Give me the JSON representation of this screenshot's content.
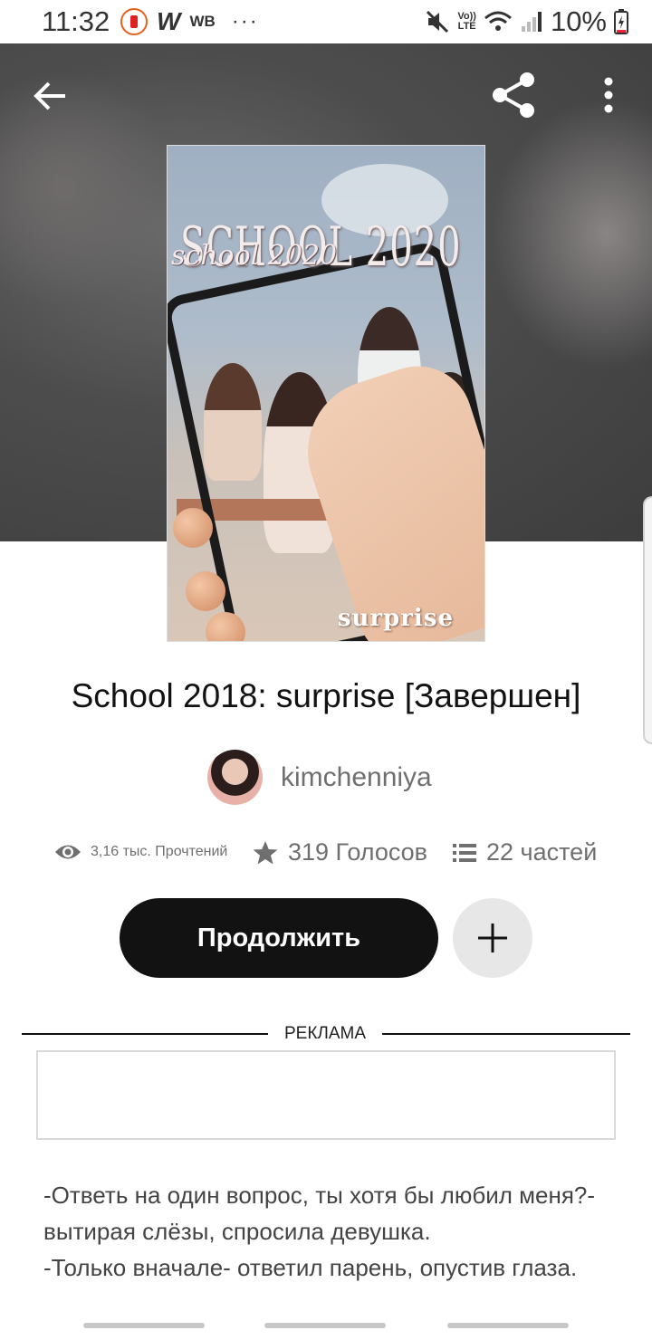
{
  "status_bar": {
    "time": "11:32",
    "app_w": "W",
    "app_wb": "WB",
    "more": "···",
    "lte_top": "Vo))",
    "lte_bottom": "LTE",
    "battery_percent": "10%",
    "icons": [
      "notification-app-icon",
      "wattpad-icon",
      "mute-icon",
      "volte-icon",
      "wifi-icon",
      "signal-icon",
      "battery-charging-icon"
    ]
  },
  "toolbar": {
    "back_icon": "arrow-left-icon",
    "share_icon": "share-icon",
    "more_icon": "more-vertical-icon"
  },
  "cover": {
    "title_print": "SCHOOL 2020",
    "title_script": "school 2020",
    "subtitle": "surprise"
  },
  "story": {
    "title": "School 2018: surprise [Завершен]",
    "author": "kimchenniya",
    "reads": "3,16 тыс. Прочтений",
    "votes": "319 Голосов",
    "parts": "22 частей"
  },
  "actions": {
    "continue_label": "Продолжить",
    "add_icon": "plus-icon"
  },
  "ad": {
    "label": "РЕКЛАМА"
  },
  "description": {
    "line1": "-Ответь на один вопрос, ты хотя бы любил меня?-вытирая слёзы, спросила девушка.",
    "line2": "-Только вначале- ответил парень, опустив глаза."
  },
  "colors": {
    "primary_button": "#121212",
    "secondary_button": "#e8e7e8",
    "muted_text": "#6f6f6f"
  }
}
